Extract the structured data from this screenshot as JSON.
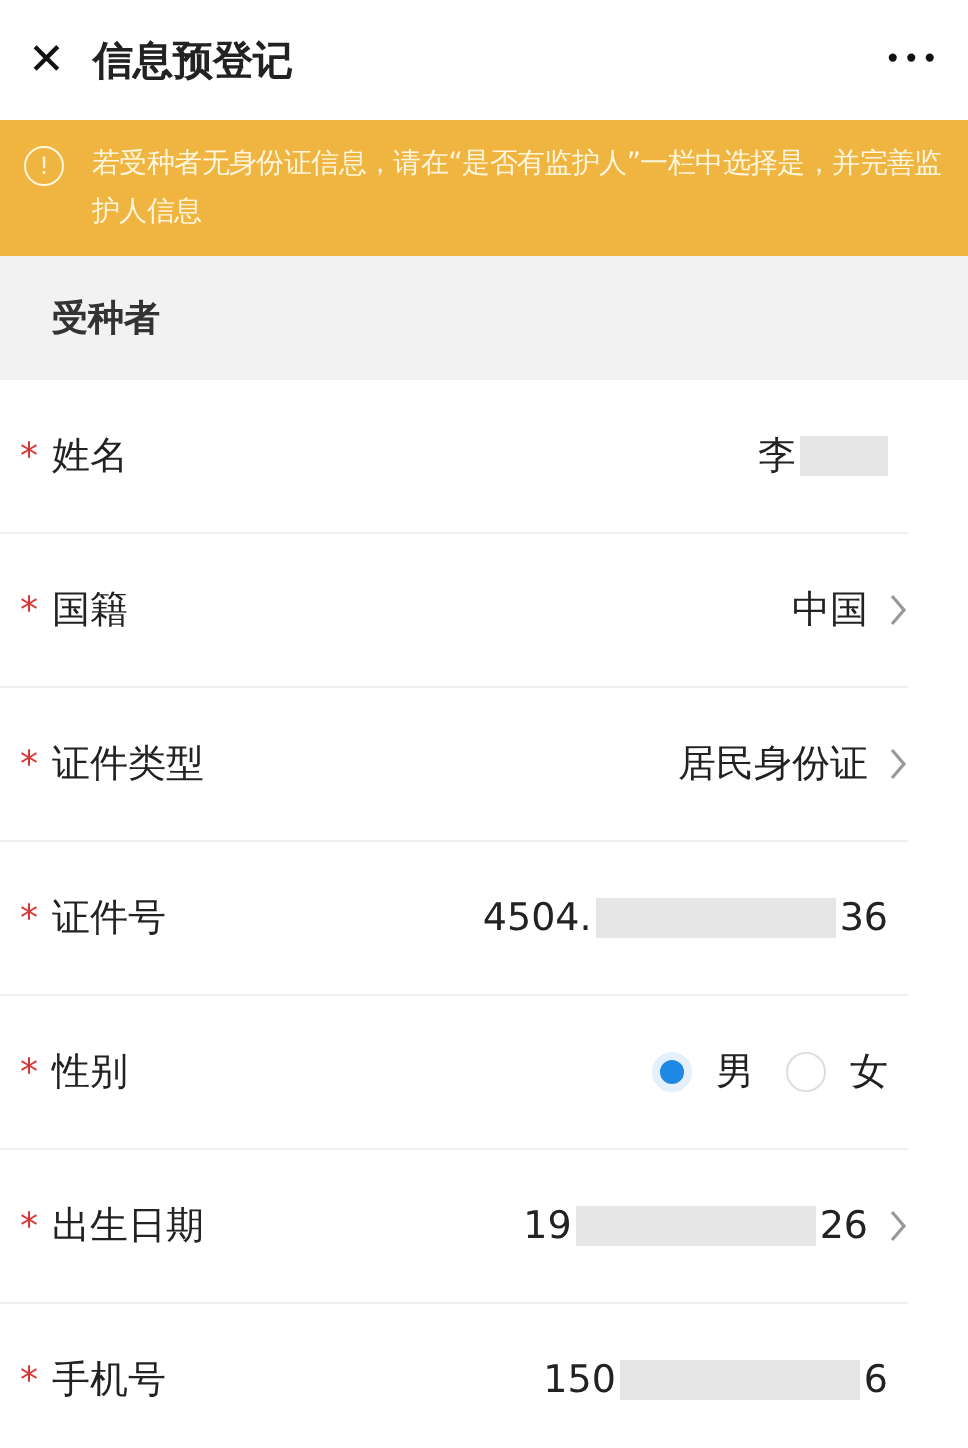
{
  "header": {
    "close_glyph": "✕",
    "title": "信息预登记",
    "more_glyph": "•••"
  },
  "notice": {
    "icon_glyph": "!",
    "text": "若受种者无身份证信息，请在“是否有监护人”一栏中选择是，并完善监护人信息"
  },
  "section": {
    "title": "受种者"
  },
  "fields": [
    {
      "kind": "text",
      "required_mark": "*",
      "label": "姓名",
      "value_prefix": "李",
      "redacted": true,
      "chevron": false
    },
    {
      "kind": "text",
      "required_mark": "*",
      "label": "国籍",
      "value_prefix": "中国",
      "redacted": false,
      "chevron": true
    },
    {
      "kind": "text",
      "required_mark": "*",
      "label": "证件类型",
      "value_prefix": "居民身份证",
      "redacted": false,
      "chevron": true
    },
    {
      "kind": "text",
      "required_mark": "*",
      "label": "证件号",
      "value_prefix": "4504.",
      "value_suffix": "36",
      "redacted": true,
      "chevron": false
    },
    {
      "kind": "radio",
      "required_mark": "*",
      "label": "性别",
      "options": [
        {
          "label": "男",
          "selected": true
        },
        {
          "label": "女",
          "selected": false
        }
      ]
    },
    {
      "kind": "text",
      "required_mark": "*",
      "label": "出生日期",
      "value_prefix": "19",
      "value_suffix": "26",
      "redacted": true,
      "chevron": true
    },
    {
      "kind": "text",
      "required_mark": "*",
      "label": "手机号",
      "value_prefix": "150",
      "value_suffix": "6",
      "redacted": true,
      "chevron": false
    }
  ]
}
